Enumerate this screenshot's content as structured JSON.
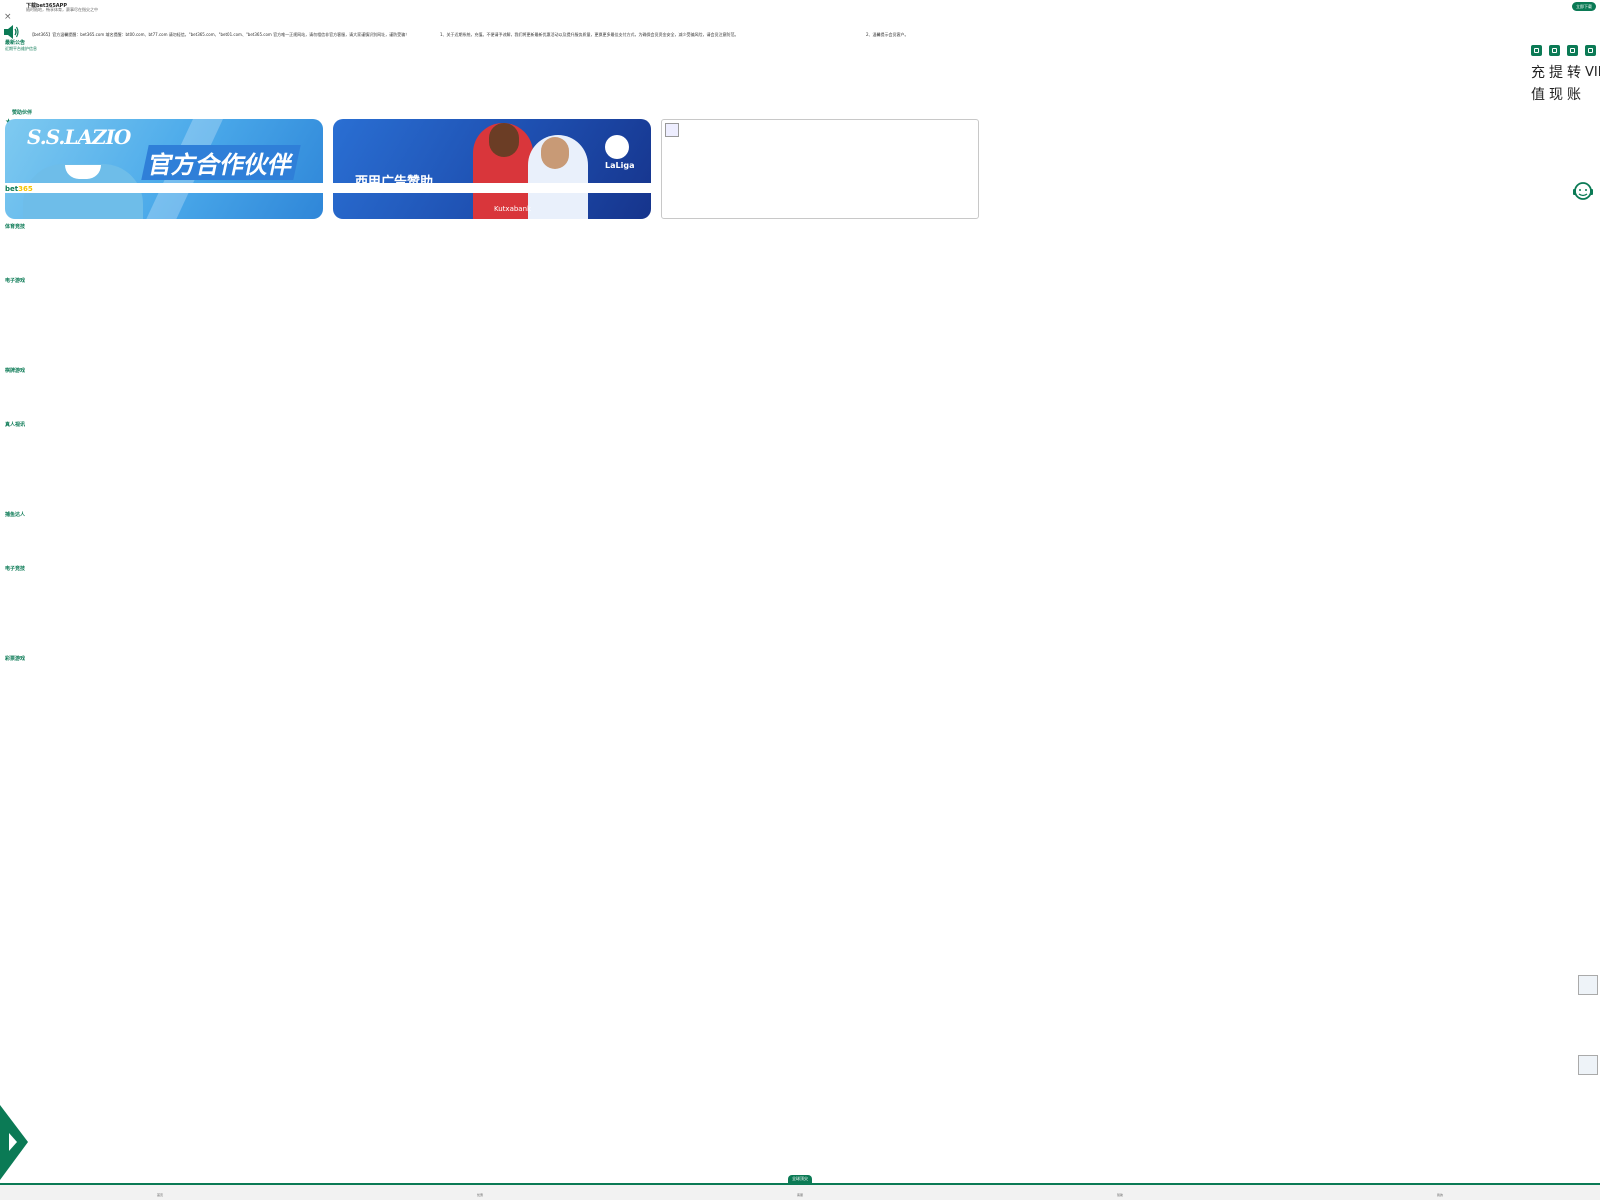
{
  "app_bar": {
    "title": "下载bet365APP",
    "subtitle": "随时随地，畅享体育，赛事尽在指尖之中",
    "download_label": "立即下载"
  },
  "notice": {
    "title": "最新公告",
    "subtitle": "近期平台维护信息",
    "ticker": [
      "【bet365】官方温馨提醒：bet365.com 域名提醒：bt00.com、bt77.com 请勿轻信，\"bet365.com、\"bet01.com、\"bet365.com 官方唯一正规网站，请勿相信非官方客服，请大家谨慎识别网址，谨防受骗！",
      "1、关于近期系统，充值。不便请予谅解，我们将更新最新优惠活动以及提升服务质量，更换更多最佳支付方式，为确保会员资金安全，减少受骗风险，请会员注意防范。",
      "2、温馨提示会员客户。"
    ]
  },
  "top_nav": {
    "items": [
      {
        "icon": "deposit-icon",
        "label": "充值"
      },
      {
        "icon": "withdraw-icon",
        "label": "提现"
      },
      {
        "icon": "transfer-icon",
        "label": "转账"
      },
      {
        "icon": "vip-icon",
        "label": "VIP"
      }
    ]
  },
  "sections": {
    "sponsor": "赞助伙伴",
    "sports": "体育竞技",
    "esports": "电子游戏",
    "chess": "棋牌游戏",
    "live": "真人视讯",
    "fishing": "捕鱼达人",
    "slots": "电子竞技",
    "lottery": "彩票游戏"
  },
  "banners": [
    {
      "heading": "S.S.LAZIO",
      "tagline": "官方合作伙伴"
    },
    {
      "heading": "西甲广告赞助",
      "brand": "LaLiga",
      "shirt_sponsor": "Kutxabank"
    },
    {
      "heading": ""
    }
  ],
  "brand": {
    "name_a": "bet",
    "name_b": "365"
  },
  "bottom_nav": {
    "center_tag": "全球顶尖",
    "items": [
      "首页",
      "优惠",
      "客服",
      "赞助",
      "我的"
    ]
  },
  "colors": {
    "accent": "#0b7a55",
    "brand_yellow": "#f5c400"
  }
}
